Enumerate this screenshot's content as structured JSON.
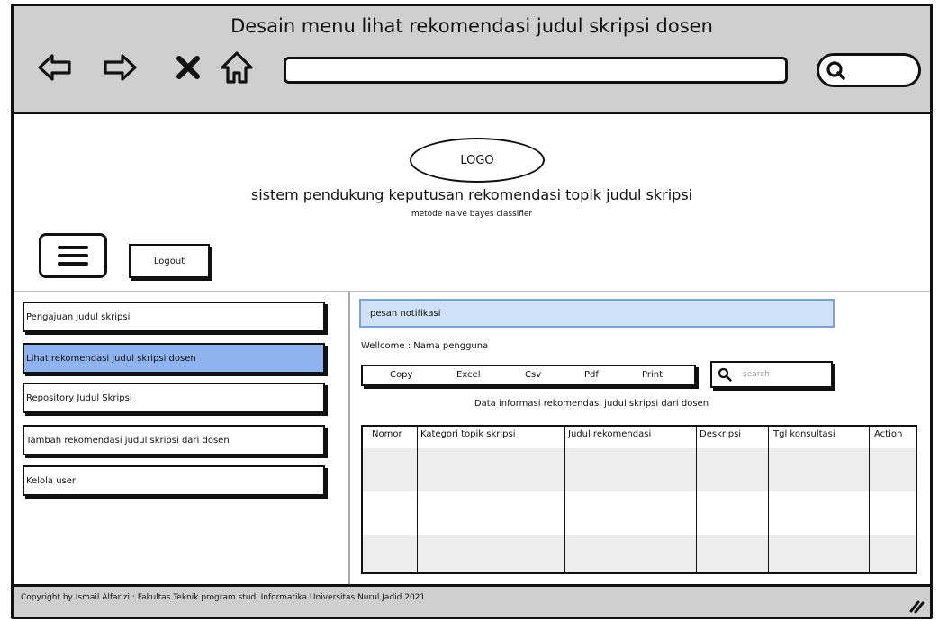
{
  "window": {
    "title": "Desain menu lihat rekomendasi judul skripsi dosen"
  },
  "browser": {
    "icons": [
      "back-arrow-icon",
      "forward-arrow-icon",
      "close-x-icon",
      "home-icon",
      "search-icon"
    ]
  },
  "header": {
    "logo_text": "LOGO",
    "title": "sistem pendukung keputusan rekomendasi topik judul skripsi",
    "subtitle": "metode naive bayes classifier",
    "logout_label": "Logout"
  },
  "sidebar": {
    "items": [
      {
        "label": "Pengajuan judul skripsi",
        "active": false
      },
      {
        "label": "Lihat rekomendasi judul skripsi dosen",
        "active": true
      },
      {
        "label": "Repository Judul Skripsi",
        "active": false
      },
      {
        "label": "Tambah rekomendasi judul skripsi dari dosen",
        "active": false
      },
      {
        "label": "Kelola user",
        "active": false
      }
    ],
    "active_color": "#8fb3ee"
  },
  "main": {
    "notification": "pesan notifikasi",
    "welcome": "Wellcome : Nama pengguna",
    "export_buttons": [
      "Copy",
      "Excel",
      "Csv",
      "Pdf",
      "Print"
    ],
    "search_placeholder": "search",
    "table_caption": "Data informasi rekomendasi judul skripsi dari dosen",
    "table": {
      "columns": [
        "Nomor",
        "Kategori topik skripsi",
        "Judul rekomendasi",
        "Deskripsi",
        "Tgl konsultasi",
        "Action"
      ],
      "rows": []
    }
  },
  "footer": {
    "text": "Copyright by Ismail Alfarizi : Fakultas Teknik program studi Informatika Universitas Nurul Jadid 2021"
  },
  "colors": {
    "chrome_gray": "#cfcfcf",
    "notification_bg": "#cfe1f7",
    "active_menu": "#8fb3ee"
  }
}
